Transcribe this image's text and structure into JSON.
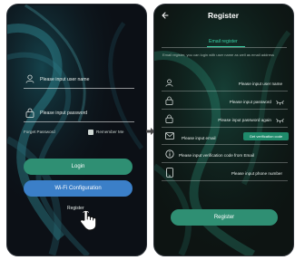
{
  "login": {
    "username_placeholder": "Please input user name",
    "password_placeholder": "Please input password",
    "forgot_password": "Forget Password",
    "remember_me": "Remember Me",
    "login_button": "Login",
    "wifi_button": "Wi-Fi Configuration",
    "register_link": "Register"
  },
  "register": {
    "title": "Register",
    "tab": "Email register",
    "note": "Email register, you can login with user name as well as email address",
    "username_placeholder": "Please input user name",
    "password_placeholder": "Please input password",
    "password_again_placeholder": "Please input password again",
    "email_placeholder": "Please input email",
    "send_code_button": "Get verification code",
    "code_placeholder": "Please input verification code from Email",
    "phone_placeholder": "Please input phone number",
    "register_button": "Register"
  },
  "colors": {
    "accent_green": "#2f8f73",
    "wifi_blue": "#3b7fc8"
  }
}
